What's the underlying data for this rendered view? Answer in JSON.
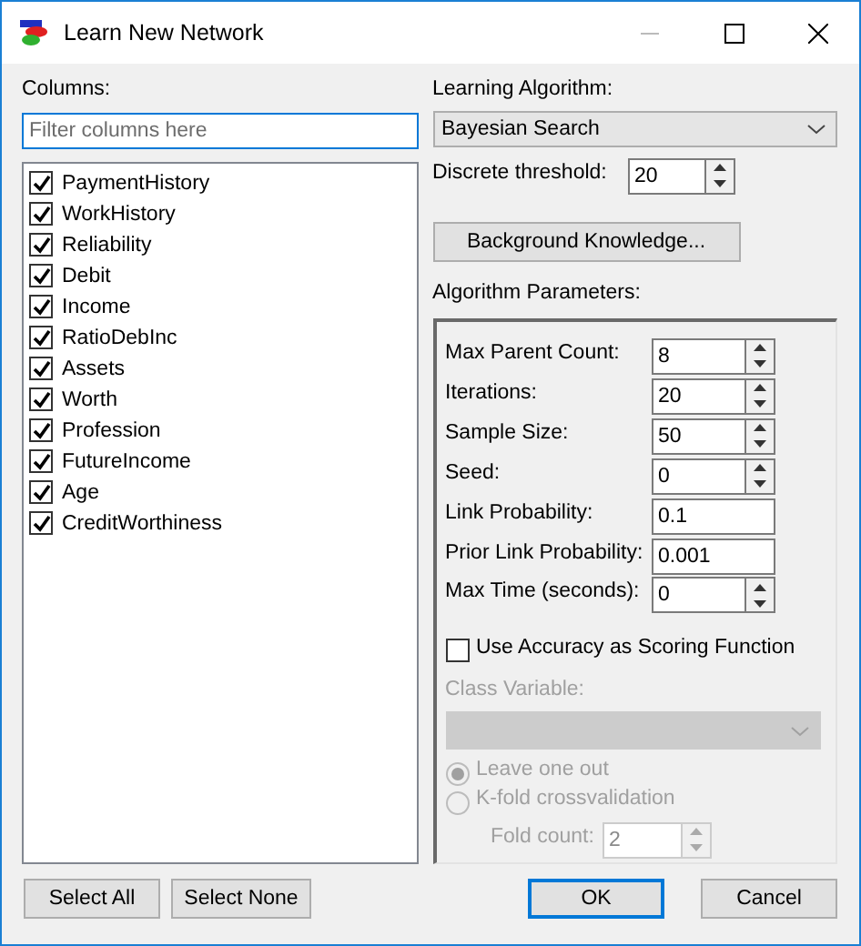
{
  "window": {
    "title": "Learn New Network"
  },
  "columns": {
    "label": "Columns:",
    "filter": {
      "placeholder": "Filter columns here"
    },
    "items": [
      {
        "label": "PaymentHistory",
        "checked": true
      },
      {
        "label": "WorkHistory",
        "checked": true
      },
      {
        "label": "Reliability",
        "checked": true
      },
      {
        "label": "Debit",
        "checked": true
      },
      {
        "label": "Income",
        "checked": true
      },
      {
        "label": "RatioDebInc",
        "checked": true
      },
      {
        "label": "Assets",
        "checked": true
      },
      {
        "label": "Worth",
        "checked": true
      },
      {
        "label": "Profession",
        "checked": true
      },
      {
        "label": "FutureIncome",
        "checked": true
      },
      {
        "label": "Age",
        "checked": true
      },
      {
        "label": "CreditWorthiness",
        "checked": true
      }
    ]
  },
  "algorithm": {
    "label": "Learning Algorithm:",
    "value": "Bayesian Search"
  },
  "threshold": {
    "label": "Discrete threshold:",
    "value": "20"
  },
  "background_button": "Background Knowledge...",
  "parameters": {
    "label": "Algorithm Parameters:",
    "fields": [
      {
        "label": "Max Parent Count:",
        "value": "8",
        "kind": "spinner"
      },
      {
        "label": "Iterations:",
        "value": "20",
        "kind": "spinner"
      },
      {
        "label": "Sample Size:",
        "value": "50",
        "kind": "spinner"
      },
      {
        "label": "Seed:",
        "value": "0",
        "kind": "spinner"
      },
      {
        "label": "Link Probability:",
        "value": "0.1",
        "kind": "text"
      },
      {
        "label": "Prior Link Probability:",
        "value": "0.001",
        "kind": "text"
      },
      {
        "label": "Max Time (seconds):",
        "value": "0",
        "kind": "spinner"
      }
    ],
    "accuracy": {
      "label": "Use Accuracy as Scoring Function",
      "checked": false
    },
    "class_variable": {
      "label": "Class Variable:",
      "disabled": true
    },
    "validation": [
      {
        "label": "Leave one out",
        "selected": true,
        "disabled": true
      },
      {
        "label": "K-fold crossvalidation",
        "selected": false,
        "disabled": true
      }
    ],
    "fold_count": {
      "label": "Fold count:",
      "value": "2",
      "disabled": true
    }
  },
  "footer": {
    "left_buttons": [
      "Select All",
      "Select None"
    ],
    "ok": "OK",
    "cancel": "Cancel"
  }
}
